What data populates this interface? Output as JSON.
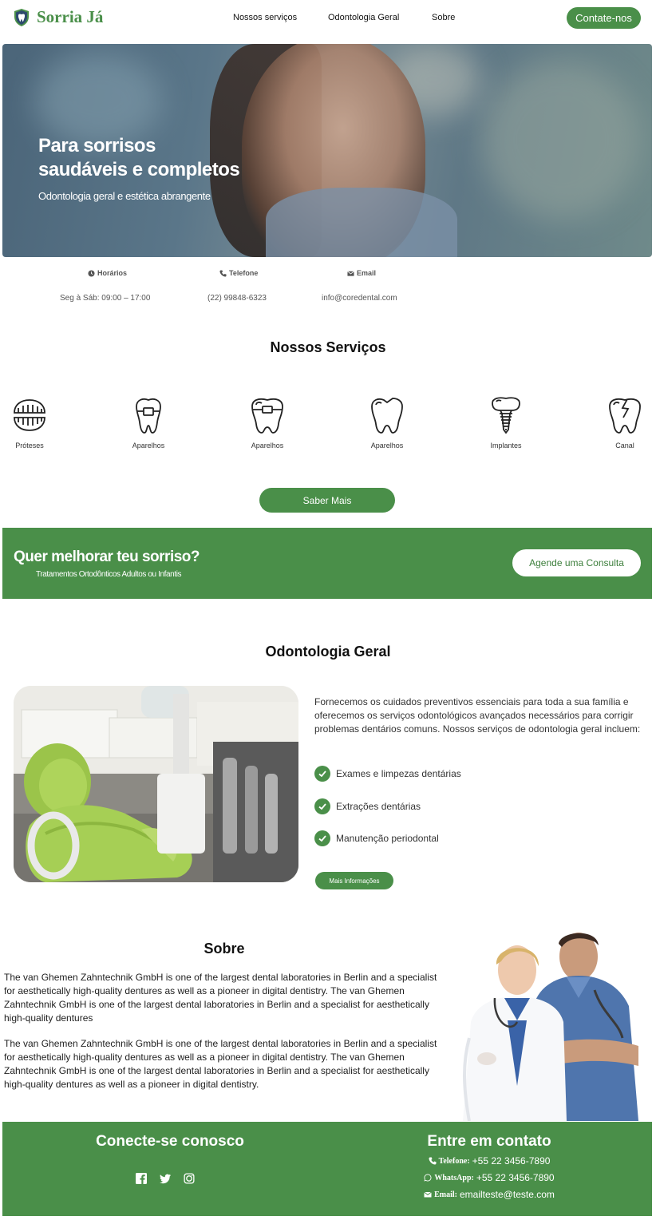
{
  "brand": {
    "name": "Sorria Já",
    "color": "#4a8f49"
  },
  "nav": {
    "links": [
      "Nossos serviços",
      "Odontologia Geral",
      "Sobre"
    ],
    "cta": "Contate-nos"
  },
  "hero": {
    "title_line1": "Para sorrisos",
    "title_line2": "saudáveis e completos",
    "subtitle": "Odontologia geral e estética abrangente"
  },
  "info": {
    "hours_label": "Horários",
    "hours_value": "Seg à Sáb: 09:00 – 17:00",
    "phone_label": "Telefone",
    "phone_value": "(22) 99848-6323",
    "email_label": "Email",
    "email_value": "info@coredental.com"
  },
  "services": {
    "title": "Nossos Serviços",
    "items": [
      {
        "label": "Próteses",
        "icon": "dentures-icon"
      },
      {
        "label": "Aparelhos",
        "icon": "braces-tooth-icon"
      },
      {
        "label": "Aparelhos",
        "icon": "braces-tooth-icon"
      },
      {
        "label": "Aparelhos",
        "icon": "tooth-icon"
      },
      {
        "label": "Implantes",
        "icon": "implant-icon"
      },
      {
        "label": "Canal",
        "icon": "cracked-tooth-icon"
      }
    ],
    "button": "Saber Mais"
  },
  "banner": {
    "title": "Quer melhorar teu sorriso?",
    "subtitle": "Tratamentos Ortodônticos Adultos ou Infantis",
    "button": "Agende uma Consulta"
  },
  "general": {
    "title": "Odontologia Geral",
    "text": "Fornecemos os cuidados preventivos essenciais para toda a sua família e oferecemos os serviços odontológicos avançados necessários para corrigir problemas dentários comuns. Nossos serviços de odontologia geral incluem:",
    "items": [
      "Exames e limpezas dentárias",
      "Extrações dentárias",
      "Manutenção periodontal"
    ],
    "button": "Mais Informações"
  },
  "about": {
    "title": "Sobre",
    "p1": "The van Ghemen Zahntechnik GmbH is one of the largest dental laboratories in Berlin and a specialist for aesthetically high-quality dentures as well as a pioneer in digital dentistry. The van Ghemen Zahntechnik GmbH is one of the largest dental laboratories in Berlin and a specialist for aesthetically high-quality dentures",
    "p2": "The van Ghemen Zahntechnik GmbH is one of the largest dental laboratories in Berlin and a specialist for aesthetically high-quality dentures as well as a pioneer in digital dentistry. The van Ghemen Zahntechnik GmbH is one of the largest dental laboratories in Berlin and a specialist for aesthetically high-quality dentures as well as a pioneer in digital dentistry."
  },
  "footer": {
    "connect_title": "Conecte-se conosco",
    "social": [
      "facebook-icon",
      "twitter-icon",
      "instagram-icon"
    ],
    "contact_title": "Entre em contato",
    "phone_key": "Telefone:",
    "phone_value": "+55 22 3456-7890",
    "whatsapp_key": "WhatsApp:",
    "whatsapp_value": "+55 22 3456-7890",
    "email_key": "Email:",
    "email_value": "emailteste@teste.com"
  }
}
